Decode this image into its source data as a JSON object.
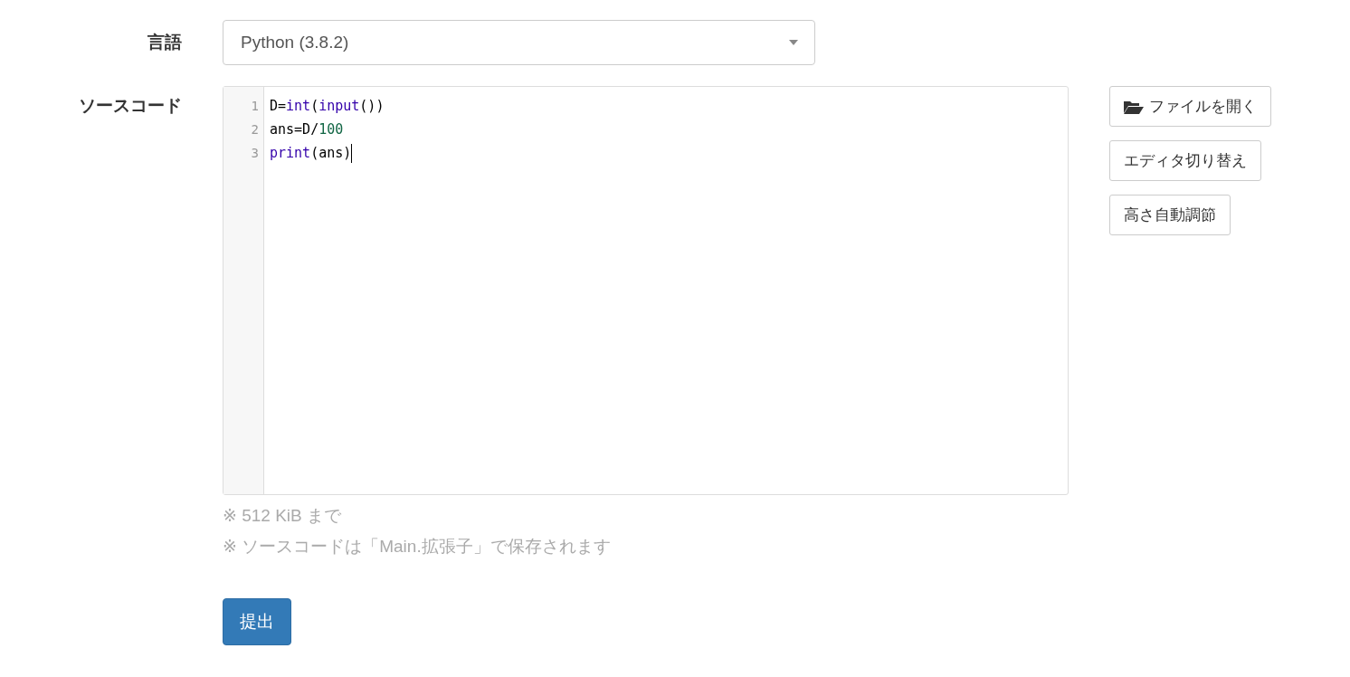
{
  "language": {
    "label": "言語",
    "value": "Python (3.8.2)"
  },
  "source": {
    "label": "ソースコード",
    "lines": [
      {
        "number": "1",
        "cursor": false,
        "tokens": [
          {
            "kind": "text",
            "text": "D="
          },
          {
            "kind": "builtin",
            "text": "int"
          },
          {
            "kind": "text",
            "text": "("
          },
          {
            "kind": "builtin",
            "text": "input"
          },
          {
            "kind": "text",
            "text": "())"
          }
        ]
      },
      {
        "number": "2",
        "cursor": false,
        "tokens": [
          {
            "kind": "text",
            "text": "ans=D/"
          },
          {
            "kind": "number",
            "text": "100"
          }
        ]
      },
      {
        "number": "3",
        "cursor": true,
        "tokens": [
          {
            "kind": "builtin",
            "text": "print"
          },
          {
            "kind": "text",
            "text": "(ans)"
          }
        ]
      }
    ],
    "notes": [
      "※ 512 KiB まで",
      "※ ソースコードは「Main.拡張子」で保存されます"
    ],
    "buttons": [
      {
        "kind": "open",
        "label": "ファイルを開く"
      },
      {
        "kind": "plain",
        "label": "エディタ切り替え"
      },
      {
        "kind": "plain",
        "label": "高さ自動調節"
      }
    ]
  },
  "submit": {
    "label": "提出"
  }
}
